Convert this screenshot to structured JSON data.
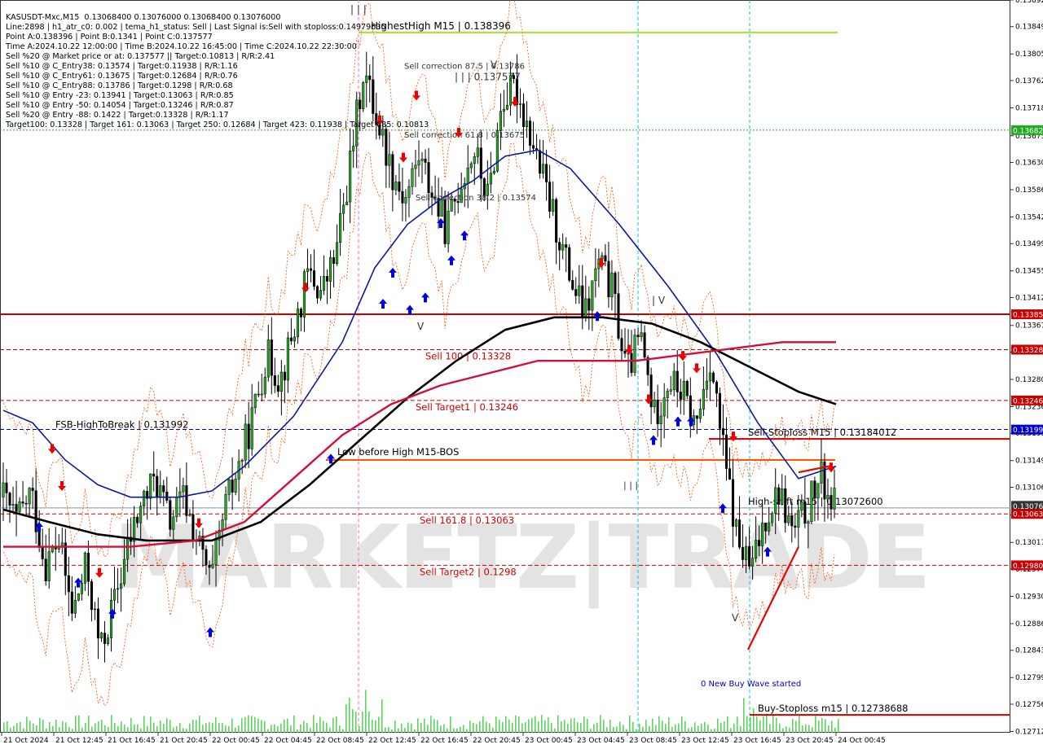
{
  "window_title": "KASUSDT-Mxc,M15  0.13068400 0.13076000 0.13068400 0.13076000",
  "info_lines": [
    "Line:2898 | h1_atr_c0: 0.002 | tema_h1_status: Sell | Last Signal is:Sell with stoploss:0.14979635",
    "Point A:0.138396 | Point B:0.1341 | Point C:0.137577",
    "Time A:2024.10.22 12:00:00 | Time B:2024.10.22 16:45:00 | Time C:2024.10.22 22:30:00",
    "Sell %20 @ Market price or at: 0.137577 || Target:0.10813 | R/R:2.41",
    "Sell %10 @ C_Entry38: 0.13574 | Target:0.11938 | R/R:1.16",
    "Sell %10 @ C_Entry61: 0.13675 | Target:0.12684 | R/R:0.76",
    "Sell %10 @ C_Entry88: 0.13786 | Target:0.1298 | R/R:0.68",
    "Sell %10 @ Entry -23: 0.13941 | Target:0.13063 | R/R:0.85",
    "Sell %10 @ Entry -50: 0.14054 | Target:0.13246 | R/R:0.87",
    "Sell %20 @ Entry -88: 0.1422 | Target:0.13328 | R/R:1.17",
    "Target100: 0.13328 | Target 161: 0.13063 | Target 250: 0.12684 | Target 423: 0.11938 | Target 685: 0.10813"
  ],
  "watermark": "MARKETZ|TRADE",
  "colors": {
    "candle": "#000000",
    "ma_blue": "#0a1a9e",
    "ma_black": "#000000",
    "ma_red": "#d0103a",
    "level_red": "#cc0000",
    "green_line": "#a6e22e",
    "cyan": "#00c8d8",
    "magenta": "#ff66cc",
    "volume": "#33cc33",
    "arrow_up": "#0000dd",
    "arrow_down": "#ee0000",
    "orange": "#ff5500",
    "navy_dash": "#0000aa"
  },
  "chart_data": {
    "type": "candlestick",
    "symbol": "KASUSDT-Mxc",
    "timeframe": "M15",
    "ylim": [
      0.1271,
      0.13892
    ],
    "y_ticks": [
      "0.13892",
      "0.13849",
      "0.13805",
      "0.13762",
      "0.13718",
      "0.13673",
      "0.13630",
      "0.13586",
      "0.13542",
      "0.13499",
      "0.13455",
      "0.13412",
      "0.13367",
      "0.13324",
      "0.13280",
      "0.13236",
      "0.13193",
      "0.13149",
      "0.13106",
      "0.13061",
      "0.13017",
      "0.12974",
      "0.12930",
      "0.12886",
      "0.12843",
      "0.12799",
      "0.12756",
      "0.12712"
    ],
    "x_ticks": [
      "21 Oct 2024",
      "21 Oct 12:45",
      "21 Oct 16:45",
      "21 Oct 20:45",
      "22 Oct 00:45",
      "22 Oct 04:45",
      "22 Oct 08:45",
      "22 Oct 12:45",
      "22 Oct 16:45",
      "22 Oct 20:45",
      "23 Oct 00:45",
      "23 Oct 04:45",
      "23 Oct 08:45",
      "23 Oct 12:45",
      "23 Oct 16:45",
      "23 Oct 20:45",
      "24 Oct 00:45"
    ],
    "price_badges": [
      {
        "text": "0.13682",
        "price": 0.13682,
        "color": "#22aa22"
      },
      {
        "text": "0.13385",
        "price": 0.13385,
        "color": "#cc0000"
      },
      {
        "text": "0.13328",
        "price": 0.13328,
        "color": "#cc0000"
      },
      {
        "text": "0.13246",
        "price": 0.13246,
        "color": "#cc0000"
      },
      {
        "text": "0.13199",
        "price": 0.13199,
        "color": "#0000cc"
      },
      {
        "text": "0.13076",
        "price": 0.13076,
        "color": "#333333"
      },
      {
        "text": "0.13063",
        "price": 0.13063,
        "color": "#cc0000"
      },
      {
        "text": "0.12980",
        "price": 0.1298,
        "color": "#cc0000"
      }
    ],
    "levels": [
      {
        "price": 0.138396,
        "label": "HighestHigh   M15 | 0.138396",
        "color": "#a6e22e",
        "style": "solid"
      },
      {
        "price": 0.13682,
        "label": "",
        "color": "#22aa22",
        "style": "dotted"
      },
      {
        "price": 0.13385,
        "label": "",
        "color": "#cc0000",
        "style": "solid"
      },
      {
        "price": 0.13328,
        "label": "Sell 100 | 0.13328",
        "color": "#cc0000",
        "style": "dashed"
      },
      {
        "price": 0.13246,
        "label": "Sell Target1 | 0.13246",
        "color": "#cc0000",
        "style": "dashed"
      },
      {
        "price": 0.131992,
        "label": "FSB-HighToBreak | 0.131992",
        "color": "#0000aa",
        "style": "dashed"
      },
      {
        "price": 0.13184012,
        "label": "Sell-Stoploss M15 | 0.13184012",
        "color": "#cc0000",
        "style": "solid"
      },
      {
        "price": 0.1315,
        "label": "Low before High   M15-BOS",
        "color": "#ff5500",
        "style": "solid"
      },
      {
        "price": 0.130726,
        "label": "High-shift m15 | 0.13072600",
        "color": "#7799aa",
        "style": "solid"
      },
      {
        "price": 0.13063,
        "label": "Sell 161.8 | 0.13063",
        "color": "#cc0000",
        "style": "dashed"
      },
      {
        "price": 0.1298,
        "label": "Sell Target2 | 0.1298",
        "color": "#cc0000",
        "style": "dashed"
      },
      {
        "price": 0.12738688,
        "label": "Buy-Stoploss m15 | 0.12738688",
        "color": "#cc0000",
        "style": "solid"
      }
    ],
    "annotations": [
      {
        "text": "| | | 0.137577",
        "price": 0.137577
      },
      {
        "text": "Sell correction 87.5 | 0.13786",
        "price": 0.13786
      },
      {
        "text": "Sell correction 61.8 | 0.13675",
        "price": 0.13675
      },
      {
        "text": "Sell correction 38.2 | 0.13574",
        "price": 0.13574
      },
      {
        "text": "0 New Buy Wave started",
        "price": 0.1279
      },
      {
        "text": "| | |",
        "price": 0.1389
      },
      {
        "text": "| V",
        "price": 0.1341
      },
      {
        "text": "V",
        "price": 0.1378
      },
      {
        "text": "V",
        "price": 0.1336
      },
      {
        "text": "V",
        "price": 0.1289
      },
      {
        "text": "| | |",
        "price": 0.1311
      }
    ],
    "series": [
      {
        "name": "",
        "kind": "close",
        "values": [
          0.1309,
          0.1305,
          0.131,
          0.1298,
          0.1302,
          0.129,
          0.1298,
          0.1284,
          0.1292,
          0.1301,
          0.1308,
          0.1312,
          0.1305,
          0.1309,
          0.1302,
          0.1295,
          0.1307,
          0.1314,
          0.1322,
          0.1332,
          0.1328,
          0.1336,
          0.1345,
          0.1342,
          0.1348,
          0.1362,
          0.1378,
          0.137,
          0.1362,
          0.1357,
          0.1364,
          0.1358,
          0.1352,
          0.136,
          0.1365,
          0.1357,
          0.1373,
          0.1375,
          0.1368,
          0.136,
          0.1352,
          0.1344,
          0.1338,
          0.1347,
          0.1342,
          0.1329,
          0.1335,
          0.1322,
          0.1328,
          0.1326,
          0.132,
          0.1332,
          0.1316,
          0.1302,
          0.1297,
          0.1306,
          0.131,
          0.1303,
          0.1307,
          0.1312,
          0.13076
        ]
      }
    ]
  }
}
